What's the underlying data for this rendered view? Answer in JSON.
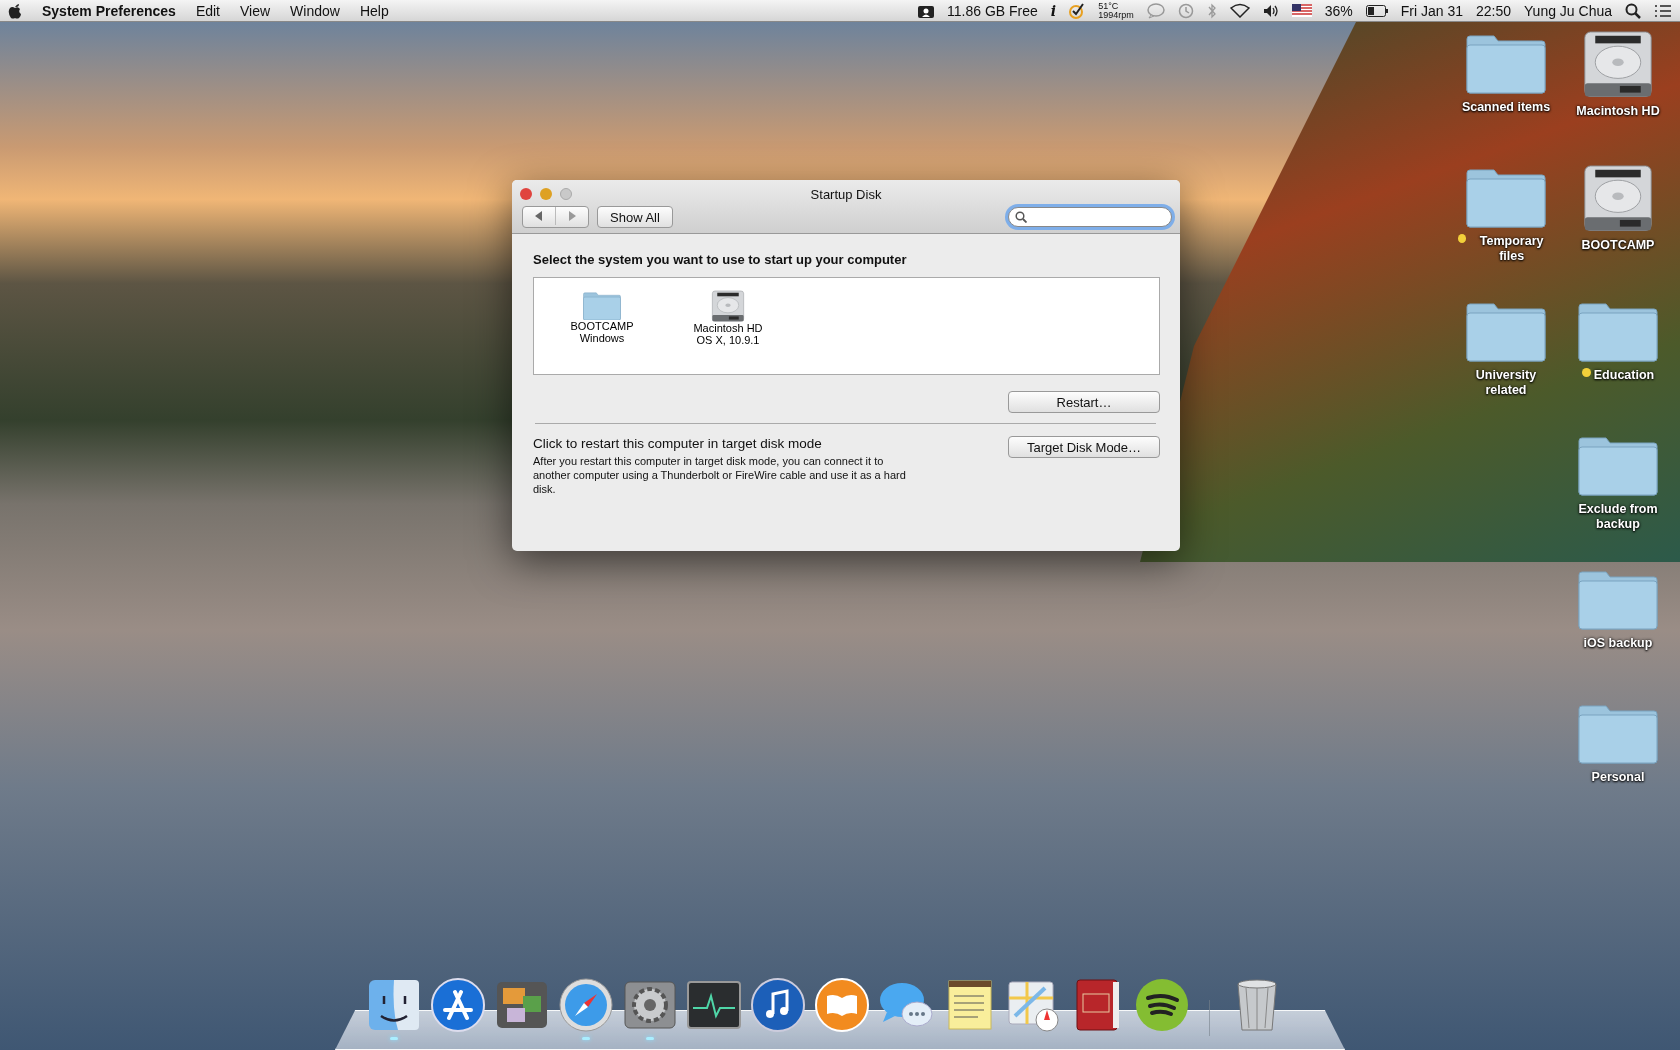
{
  "menu_bar": {
    "app_name": "System Preferences",
    "menus": [
      "Edit",
      "View",
      "Window",
      "Help"
    ],
    "disk_free": "11.86 GB Free",
    "info_glyph": "i",
    "temperature": "51°C",
    "fan_speed": "1994rpm",
    "battery_percent": "36%",
    "date": "Fri Jan 31",
    "time": "22:50",
    "user_name": "Yung Ju Chua"
  },
  "window": {
    "title": "Startup Disk",
    "show_all": "Show All",
    "search_focused": true,
    "heading": "Select the system you want to use to start up your computer",
    "disks": [
      {
        "name": "BOOTCAMP",
        "detail": "Windows",
        "kind": "folder",
        "selected": false
      },
      {
        "name": "Macintosh HD",
        "detail": "OS X, 10.9.1",
        "kind": "drive",
        "selected": false
      }
    ],
    "restart_button": "Restart…",
    "target_heading": "Click to restart this computer in target disk mode",
    "target_text": "After you restart this computer in target disk mode, you can connect it to another computer using a Thunderbolt or FireWire cable and use it as a hard disk.",
    "target_button": "Target Disk Mode…"
  },
  "desktop_icons": [
    {
      "label": "Scanned items",
      "kind": "folder"
    },
    {
      "label": "Macintosh HD",
      "kind": "drive"
    },
    {
      "label": "Temporary files",
      "kind": "folder",
      "color": "#f2d03a"
    },
    {
      "label": "BOOTCAMP",
      "kind": "drive"
    },
    {
      "label": "University related",
      "kind": "folder"
    },
    {
      "label": "Education",
      "kind": "folder",
      "color": "#f2d03a"
    },
    {
      "label": "Exclude from backup",
      "kind": "folder"
    },
    {
      "label": "iOS backup",
      "kind": "folder"
    },
    {
      "label": "Personal",
      "kind": "folder"
    }
  ],
  "dock": [
    {
      "kind": "finder",
      "running": true
    },
    {
      "kind": "appstore",
      "running": false
    },
    {
      "kind": "photos",
      "running": false
    },
    {
      "kind": "safari",
      "running": true
    },
    {
      "kind": "preferences",
      "running": true
    },
    {
      "kind": "activity",
      "running": false
    },
    {
      "kind": "itunes",
      "running": false
    },
    {
      "kind": "ibooks",
      "running": false
    },
    {
      "kind": "messages",
      "running": false
    },
    {
      "kind": "stickies",
      "running": false
    },
    {
      "kind": "maps",
      "running": false
    },
    {
      "kind": "dictionary",
      "running": false
    },
    {
      "kind": "spotify",
      "running": false
    },
    {
      "kind": "trash",
      "running": false
    }
  ]
}
